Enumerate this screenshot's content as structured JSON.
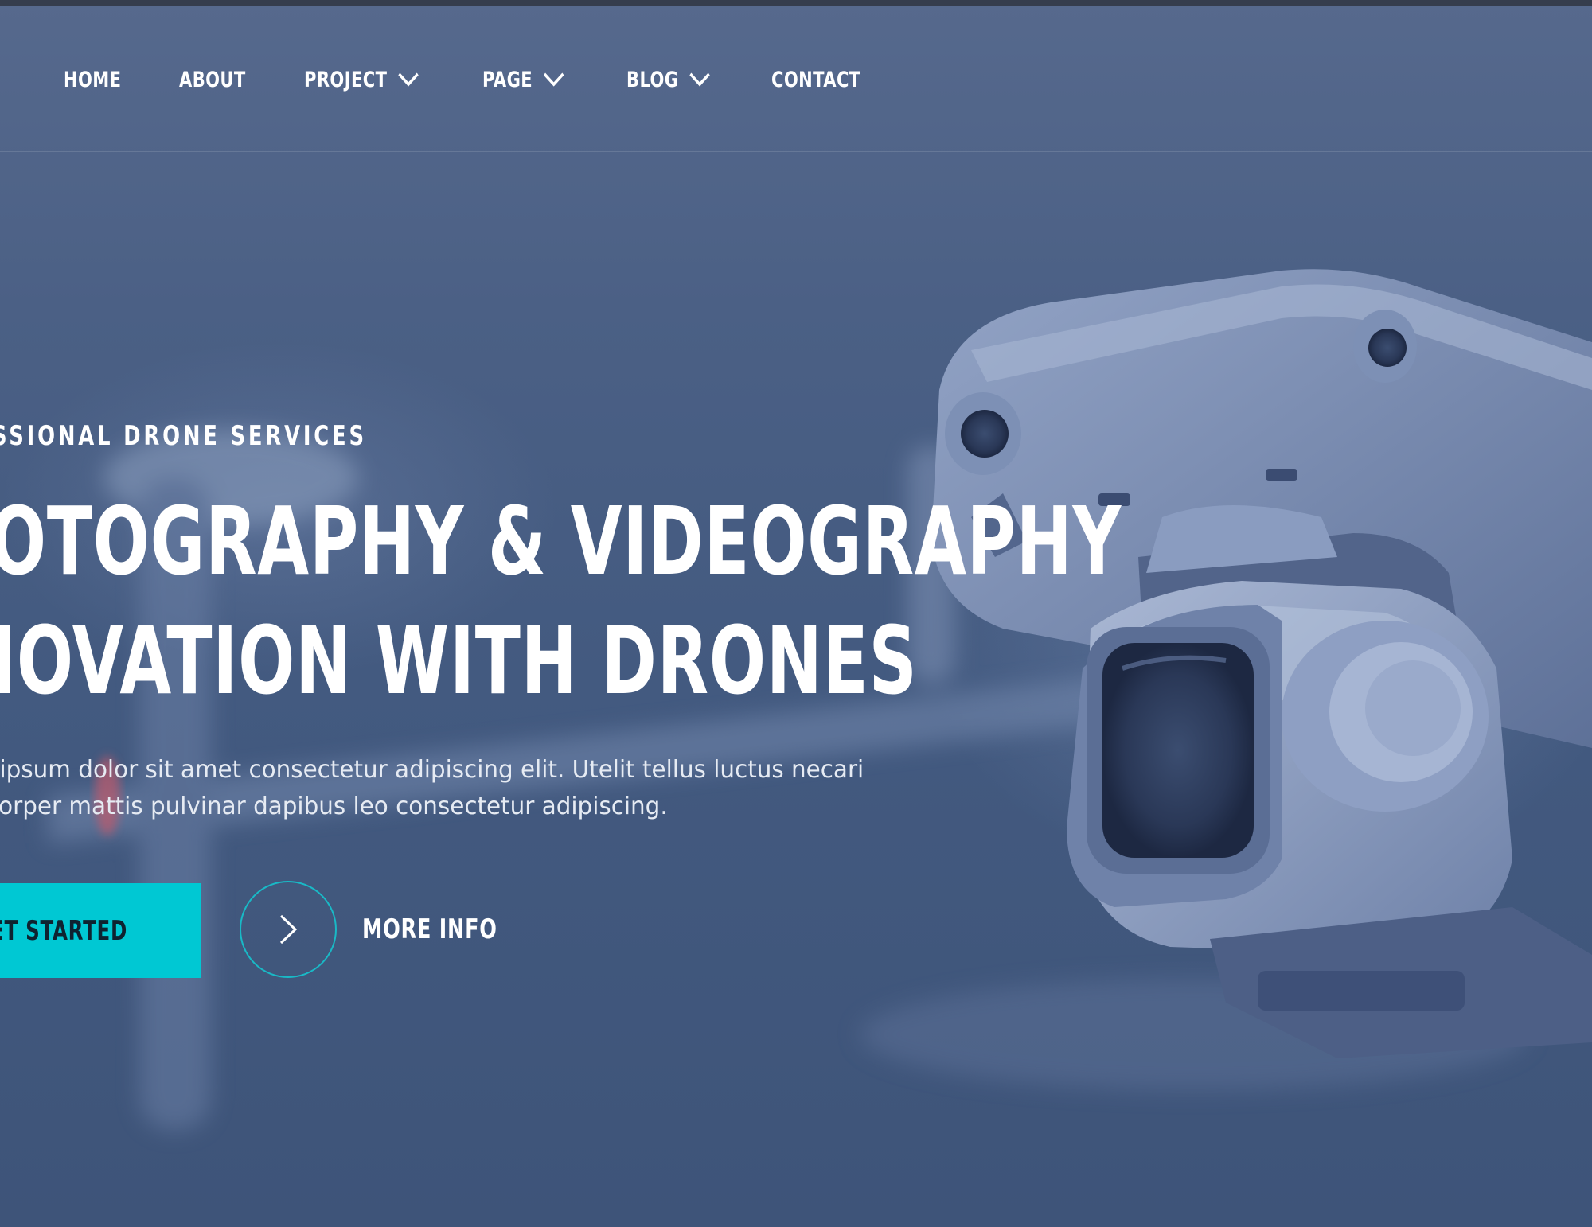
{
  "nav": {
    "items": [
      {
        "label": "HOME",
        "has_dropdown": false
      },
      {
        "label": "ABOUT",
        "has_dropdown": false
      },
      {
        "label": "PROJECT",
        "has_dropdown": true
      },
      {
        "label": "PAGE",
        "has_dropdown": true
      },
      {
        "label": "BLOG",
        "has_dropdown": true
      },
      {
        "label": "CONTACT",
        "has_dropdown": false
      }
    ]
  },
  "hero": {
    "kicker": "SSIONAL DRONE SERVICES",
    "headline_line1": "IOTOGRAPHY & VIDEOGRAPHY",
    "headline_line2": "NOVATION WITH DRONES",
    "description_line1": "ı ipsum dolor sit amet consectetur adipiscing elit. Utelit tellus luctus necari",
    "description_line2": "corper mattis pulvinar dapibus leo consectetur adipiscing.",
    "primary_button": "ET STARTED",
    "secondary_button": "MORE INFO"
  },
  "colors": {
    "accent": "#00c8d3",
    "circle_border": "#19b9c6",
    "background": "#455c82",
    "text": "#ffffff"
  },
  "icons": {
    "dropdown": "chevron-down-icon",
    "more_info": "chevron-right-icon"
  }
}
